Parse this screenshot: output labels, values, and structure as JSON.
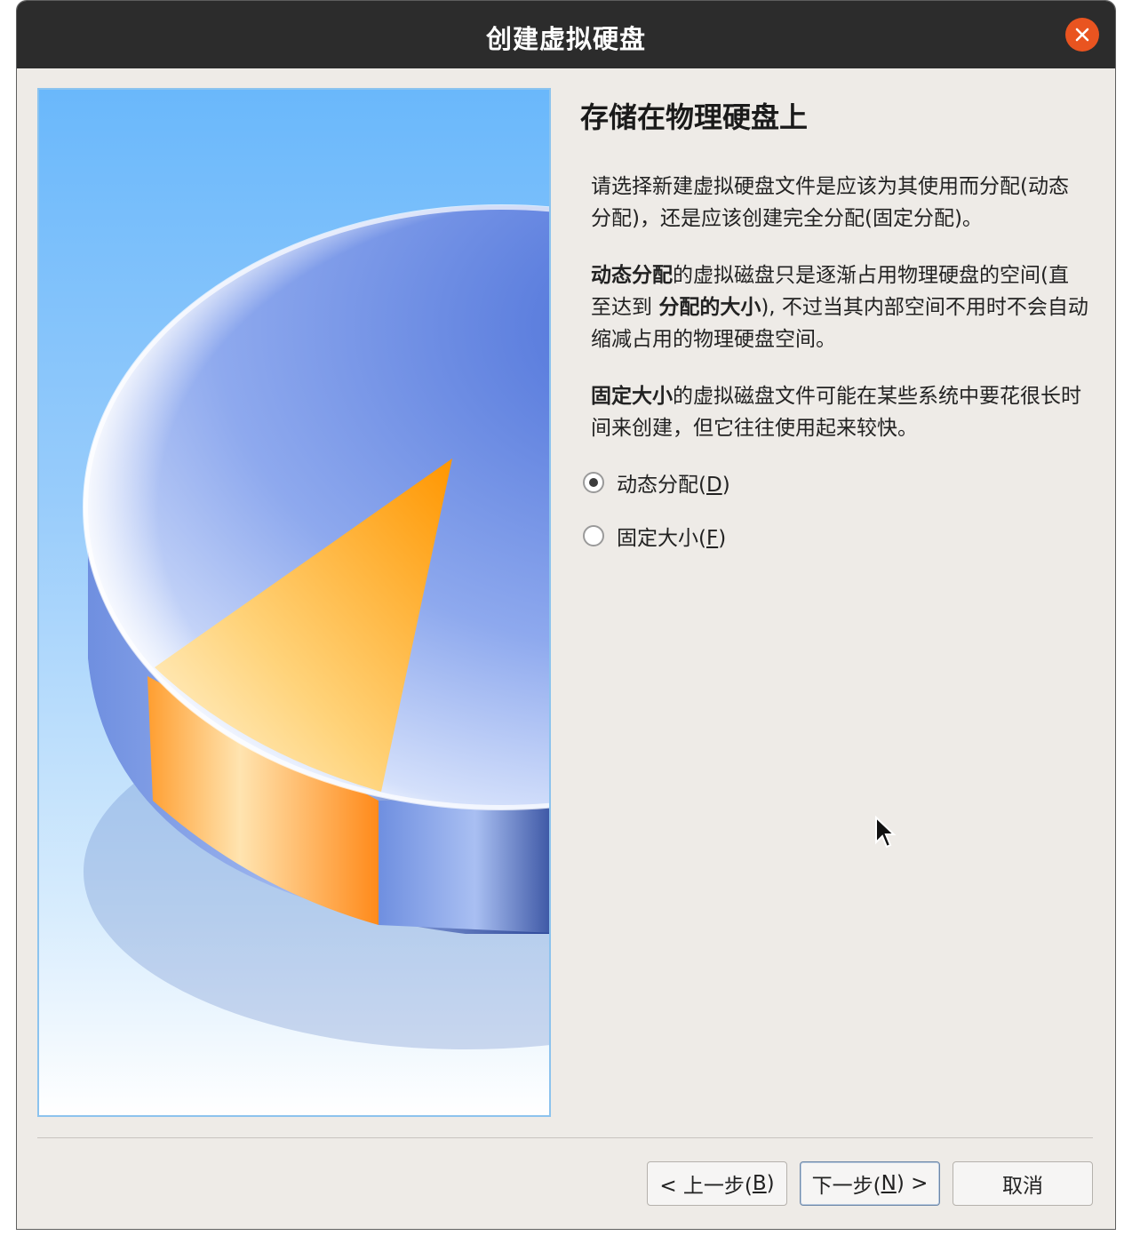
{
  "window": {
    "title": "创建虚拟硬盘",
    "close_icon": "close-icon"
  },
  "main": {
    "heading": "存储在物理硬盘上",
    "intro": "请选择新建虚拟硬盘文件是应该为其使用而分配(动态分配)，还是应该创建完全分配(固定分配)。",
    "dynamic_desc": {
      "bold1": "动态分配",
      "text1": "的虚拟磁盘只是逐渐占用物理硬盘的空间(直至达到 ",
      "bold2": "分配的大小",
      "text2": "), 不过当其内部空间不用时不会自动缩减占用的物理硬盘空间。"
    },
    "fixed_desc": {
      "bold1": "固定大小",
      "text1": "的虚拟磁盘文件可能在某些系统中要花很长时间来创建，但它往往使用起来较快。"
    },
    "options": [
      {
        "label_pre": "动态分配(",
        "mnemonic": "D",
        "label_post": ")",
        "checked": true
      },
      {
        "label_pre": "固定大小(",
        "mnemonic": "F",
        "label_post": ")",
        "checked": false
      }
    ]
  },
  "buttons": {
    "back": {
      "pre": "< 上一步(",
      "mnemonic": "B",
      "post": ")"
    },
    "next": {
      "pre": "下一步(",
      "mnemonic": "N",
      "post": ") >"
    },
    "cancel": "取消"
  },
  "colors": {
    "titlebar": "#2c2c2c",
    "close": "#e95420",
    "background": "#eeebe7",
    "accent_orange": "#ff9a1a",
    "disk_blue": "#5a7fdc"
  }
}
